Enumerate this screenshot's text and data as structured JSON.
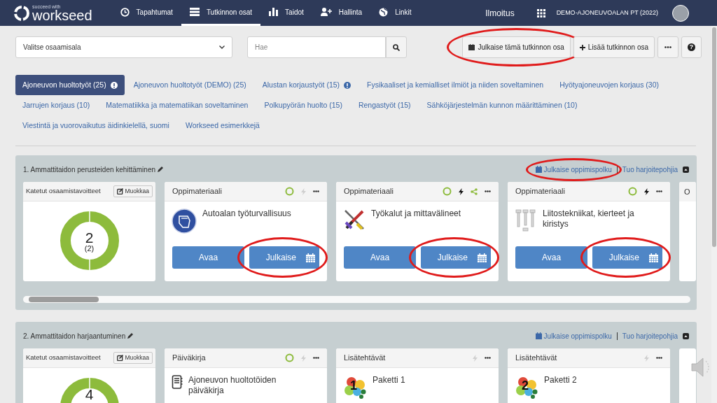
{
  "nav": {
    "logo_tag": "succeed with",
    "logo": "workseed",
    "items": [
      {
        "label": "Tapahtumat",
        "selected": false
      },
      {
        "label": "Tutkinnon osat",
        "selected": true
      },
      {
        "label": "Taidot",
        "selected": false
      },
      {
        "label": "Hallinta",
        "selected": false
      },
      {
        "label": "Linkit",
        "selected": false
      }
    ],
    "notice": "Ilmoitus",
    "org": "DEMO-AJONEUVOALAN PT (2022)"
  },
  "toolbar": {
    "select": "Valitse osaamisala",
    "search_placeholder": "Hae",
    "buttons": [
      {
        "kind": "publish",
        "label": "Julkaise tämä tutkinnon osa",
        "highlighted": true
      },
      {
        "kind": "add",
        "label": "Lisää tutkinnon osa",
        "highlighted": false
      },
      {
        "kind": "more",
        "highlighted": false
      },
      {
        "kind": "help",
        "label": "?",
        "highlighted": false
      }
    ]
  },
  "subjects": [
    {
      "label": "Ajoneuvon huoltotyöt (25)",
      "selected": true,
      "alert": true
    },
    {
      "label": "Ajoneuvon huoltotyöt (DEMO) (25)",
      "selected": false,
      "alert": false
    },
    {
      "label": "Alustan korjaustyöt (15)",
      "selected": false,
      "alert": true
    },
    {
      "label": "Fysikaaliset ja kemialliset ilmiöt ja niiden soveltaminen",
      "selected": false,
      "alert": false
    },
    {
      "label": "Hyötyajoneuvojen korjaus (30)",
      "selected": false,
      "alert": false
    },
    {
      "label": "Jarrujen korjaus (10)",
      "selected": false,
      "alert": false
    },
    {
      "label": "Matematiikka ja matematiikan soveltaminen",
      "selected": false,
      "alert": false
    },
    {
      "label": "Polkupyörän huolto (15)",
      "selected": false,
      "alert": false
    },
    {
      "label": "Rengastyöt (15)",
      "selected": false,
      "alert": false
    },
    {
      "label": "Sähköjärjestelmän kunnon määrittäminen (10)",
      "selected": false,
      "alert": false
    },
    {
      "label": "Viestintä ja vuorovaikutus äidinkielellä, suomi",
      "selected": false,
      "alert": false
    },
    {
      "label": "Workseed esimerkkejä",
      "selected": false,
      "alert": false
    }
  ],
  "sections": [
    {
      "title": "1. Ammattitaidon perusteiden kehittäminen",
      "publish_link": "Julkaise oppimispolku",
      "publish_highlighted": true,
      "template_link": "Tuo harjoitepohjia",
      "scrollbar": true,
      "goals": {
        "title": "Katetut osaamistavoitteet",
        "edit": "Muokkaa",
        "count": "2",
        "total": "(2)"
      },
      "cards": [
        {
          "kind": "material",
          "type": "Oppimateriaali",
          "title": "Autoalan työturvallisuus",
          "status": true,
          "bolt_active": false,
          "shared": false,
          "open": "Avaa",
          "publish": "Julkaise",
          "publish_highlighted": true
        },
        {
          "kind": "material",
          "type": "Oppimateriaali",
          "title": "Työkalut ja mittavälineet",
          "status": true,
          "bolt_active": true,
          "shared": true,
          "open": "Avaa",
          "publish": "Julkaise",
          "publish_highlighted": true
        },
        {
          "kind": "material",
          "type": "Oppimateriaali",
          "title": "Liitostekniikat, kierteet ja kiristys",
          "status": true,
          "bolt_active": true,
          "shared": false,
          "open": "Avaa",
          "publish": "Julkaise",
          "publish_highlighted": true
        },
        {
          "kind": "partial",
          "type": "O"
        }
      ]
    },
    {
      "title": "2. Ammattitaidon harjaantuminen",
      "publish_link": "Julkaise oppimispolku",
      "publish_highlighted": false,
      "template_link": "Tuo harjoitepohjia",
      "scrollbar": false,
      "goals": {
        "title": "Katetut osaamistavoitteet",
        "edit": "Muokkaa",
        "count": "4"
      },
      "cards": [
        {
          "kind": "diary",
          "type": "Päiväkirja",
          "title": "Ajoneuvon huoltotöiden päiväkirja",
          "status": true,
          "bolt_active": false,
          "shared": false
        },
        {
          "kind": "package",
          "type": "Lisätehtävät",
          "title": "Paketti 1",
          "badge": "1",
          "status": false,
          "bolt_active": false,
          "shared": false
        },
        {
          "kind": "package",
          "type": "Lisätehtävät",
          "title": "Paketti 2",
          "badge": "2",
          "status": false,
          "bolt_active": false,
          "shared": false
        },
        {
          "kind": "partial"
        }
      ]
    }
  ]
}
